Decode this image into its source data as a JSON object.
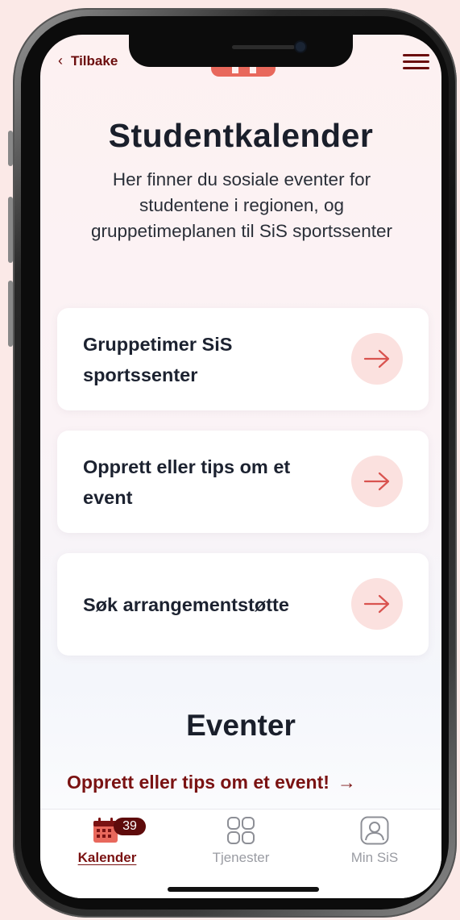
{
  "header": {
    "back_label": "Tilbake"
  },
  "page": {
    "title": "Studentkalender",
    "intro": "Her finner du sosiale eventer for studentene i regionen, og gruppetimeplanen til SiS sportssenter"
  },
  "cards": [
    {
      "label": "Gruppetimer SiS sportssenter"
    },
    {
      "label": "Opprett eller tips om et event"
    },
    {
      "label": "Søk arrangementstøtte"
    }
  ],
  "events": {
    "title": "Eventer",
    "link_label": "Opprett eller tips om et event!",
    "link_arrow": "→"
  },
  "tabbar": {
    "tabs": [
      {
        "label": "Kalender",
        "icon": "calendar-icon",
        "badge": "39",
        "active": true
      },
      {
        "label": "Tjenester",
        "icon": "grid-icon",
        "active": false
      },
      {
        "label": "Min SiS",
        "icon": "profile-icon",
        "active": false
      }
    ]
  },
  "colors": {
    "brand_dark": "#7a1212",
    "accent": "#e8685c",
    "arrow_bg": "#fbe1df",
    "text_dark": "#1a1f2b",
    "background": "#fbe9e7"
  }
}
